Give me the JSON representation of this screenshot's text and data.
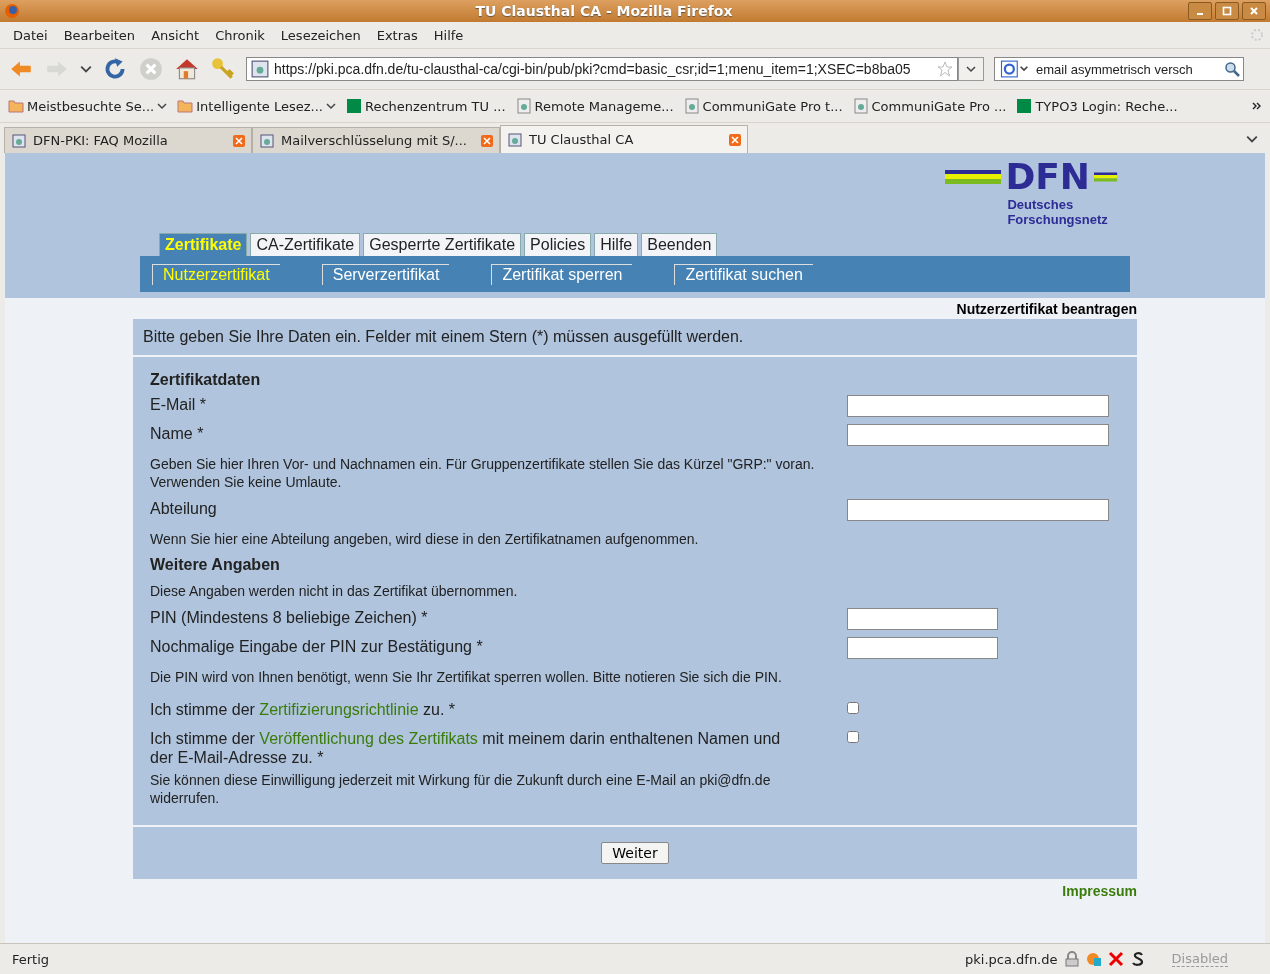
{
  "window": {
    "title": "TU Clausthal CA - Mozilla Firefox"
  },
  "menu": [
    "Datei",
    "Bearbeiten",
    "Ansicht",
    "Chronik",
    "Lesezeichen",
    "Extras",
    "Hilfe"
  ],
  "toolbar": {
    "url": "https://pki.pca.dfn.de/tu-clausthal-ca/cgi-bin/pub/pki?cmd=basic_csr;id=1;menu_item=1;XSEC=b8ba05",
    "search": "email asymmetrisch versch"
  },
  "bookmarks": [
    {
      "label": "Meistbesuchte Se...",
      "kind": "folder"
    },
    {
      "label": "Intelligente Lesez...",
      "kind": "folder"
    },
    {
      "label": "Rechenzentrum TU ...",
      "kind": "site"
    },
    {
      "label": "Remote Manageme...",
      "kind": "page"
    },
    {
      "label": "CommuniGate Pro t...",
      "kind": "page"
    },
    {
      "label": "CommuniGate Pro ...",
      "kind": "page"
    },
    {
      "label": "TYPO3 Login: Reche...",
      "kind": "site"
    }
  ],
  "browser_tabs": [
    {
      "title": "DFN-PKI: FAQ Mozilla",
      "selected": false
    },
    {
      "title": "Mailverschlüsselung mit S/...",
      "selected": false
    },
    {
      "title": "TU Clausthal CA",
      "selected": true
    }
  ],
  "logo": {
    "name": "DFN",
    "subtitle_1": "Deutsches",
    "subtitle_2": "Forschungsnetz"
  },
  "main_tabs": [
    {
      "label": "Zertifikate",
      "selected": true
    },
    {
      "label": "CA-Zertifikate",
      "selected": false
    },
    {
      "label": "Gesperrte Zertifikate",
      "selected": false
    },
    {
      "label": "Policies",
      "selected": false
    },
    {
      "label": "Hilfe",
      "selected": false
    },
    {
      "label": "Beenden",
      "selected": false
    }
  ],
  "sub_tabs": [
    {
      "label": "Nutzerzertifikat",
      "selected": true
    },
    {
      "label": "Serverzertifikat",
      "selected": false
    },
    {
      "label": "Zertifikat sperren",
      "selected": false
    },
    {
      "label": "Zertifikat suchen",
      "selected": false
    }
  ],
  "page_title": "Nutzerzertifikat beantragen",
  "intro": "Bitte geben Sie Ihre Daten ein. Felder mit einem Stern (*) müssen ausgefüllt werden.",
  "form": [
    {
      "kind": "heading",
      "text": "Zertifikatdaten"
    },
    {
      "kind": "text",
      "label": "E-Mail *"
    },
    {
      "kind": "text",
      "label": "Name *"
    },
    {
      "kind": "note",
      "text": "Geben Sie hier Ihren Vor- und Nachnamen ein. Für Gruppenzertifikate stellen Sie das Kürzel \"GRP:\" voran. Verwenden Sie keine Umlaute."
    },
    {
      "kind": "text",
      "label": "Abteilung"
    },
    {
      "kind": "note",
      "text": "Wenn Sie hier eine Abteilung angeben, wird diese in den Zertifikatnamen aufgenommen."
    },
    {
      "kind": "heading",
      "text": "Weitere Angaben"
    },
    {
      "kind": "note",
      "text": "Diese Angaben werden nicht in das Zertifikat übernommen."
    },
    {
      "kind": "pin",
      "label": "PIN (Mindestens 8 beliebige Zeichen) *"
    },
    {
      "kind": "pin",
      "label": "Nochmalige Eingabe der PIN zur Bestätigung *"
    },
    {
      "kind": "note",
      "text": "Die PIN wird von Ihnen benötigt, wenn Sie Ihr Zertifikat sperren wollen. Bitte notieren Sie sich die PIN."
    },
    {
      "kind": "checkbox",
      "before": "Ich stimme der ",
      "link": "Zertifizierungsrichtlinie",
      "after": " zu. *",
      "checked": false
    },
    {
      "kind": "checkbox",
      "before": "Ich stimme der ",
      "link": "Veröffentlichung des Zertifikats",
      "after": " mit meinem darin enthaltenen Namen und der E-Mail-Adresse zu. *",
      "checked": false
    },
    {
      "kind": "note",
      "text": "Sie können diese Einwilligung jederzeit mit Wirkung für die Zukunft durch eine E-Mail an pki@dfn.de widerrufen."
    }
  ],
  "submit": "Weiter",
  "impressum": "Impressum",
  "status": {
    "text": "Fertig",
    "host": "pki.pca.dfn.de",
    "addon": "Disabled"
  }
}
